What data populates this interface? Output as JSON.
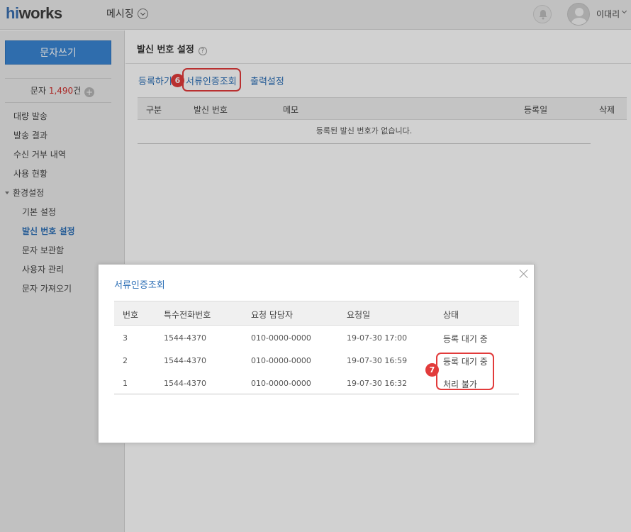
{
  "app": {
    "logo_hi": "hi",
    "logo_rest": "works",
    "menu_label": "메시징",
    "user_name": "이대리"
  },
  "sidebar": {
    "compose_label": "문자쓰기",
    "credit_prefix": "문자 ",
    "credit_count": "1,490",
    "credit_suffix": "건",
    "credit_plus": "+",
    "items": [
      {
        "label": "대량 발송"
      },
      {
        "label": "발송 결과"
      },
      {
        "label": "수신 거부 내역"
      },
      {
        "label": "사용 현황"
      },
      {
        "label": "환경설정"
      },
      {
        "label": "기본 설정"
      },
      {
        "label": "발신 번호 설정"
      },
      {
        "label": "문자 보관함"
      },
      {
        "label": "사용자 관리"
      },
      {
        "label": "문자 가져오기"
      }
    ]
  },
  "main": {
    "title": "발신 번호 설정",
    "help": "?",
    "tabs": [
      {
        "label": "등록하기"
      },
      {
        "label": "서류인증조회"
      },
      {
        "label": "출력설정"
      }
    ],
    "step_tab": "6",
    "columns": [
      "구분",
      "발신 번호",
      "메모",
      "등록일",
      "삭제"
    ],
    "empty_message": "등록된 발신 번호가 없습니다."
  },
  "modal": {
    "title": "서류인증조회",
    "columns": [
      "번호",
      "특수전화번호",
      "요청 담당자",
      "요청일",
      "상태"
    ],
    "rows": [
      {
        "no": "3",
        "phone": "1544-4370",
        "requester": "010-0000-0000",
        "date": "19-07-30 17:00",
        "status": "등록 대기 중"
      },
      {
        "no": "2",
        "phone": "1544-4370",
        "requester": "010-0000-0000",
        "date": "19-07-30 16:59",
        "status": "등록 대기 중"
      },
      {
        "no": "1",
        "phone": "1544-4370",
        "requester": "010-0000-0000",
        "date": "19-07-30 16:32",
        "status": "처리 불가"
      }
    ],
    "step_status": "7"
  },
  "colors": {
    "accent": "#2d6fb6",
    "compose_bg": "#3a86d4",
    "highlight": "#e23b3b",
    "credit": "#d0302e"
  }
}
